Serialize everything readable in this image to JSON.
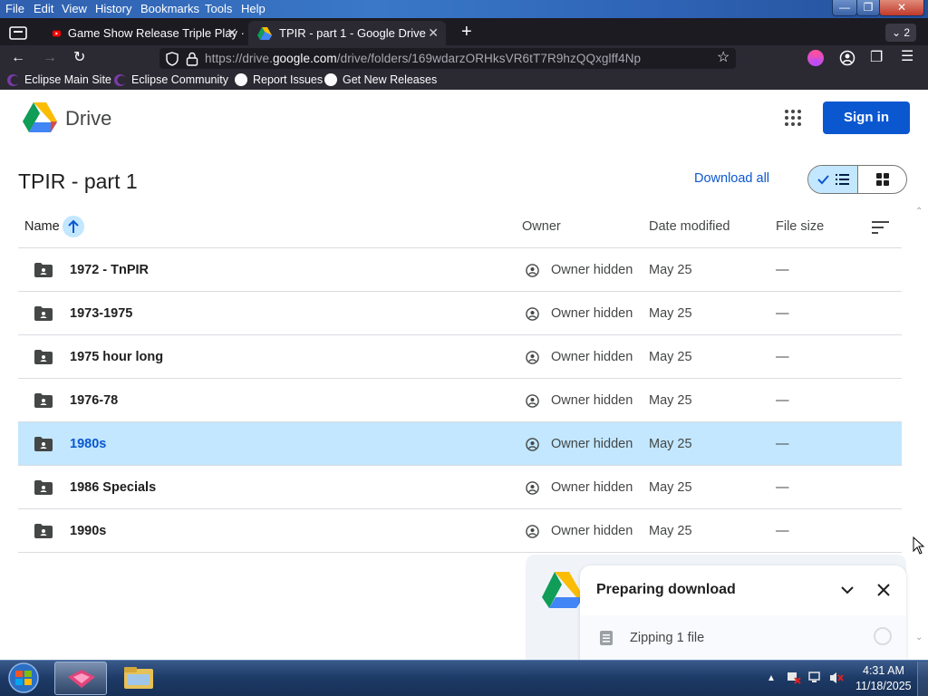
{
  "browser": {
    "menu": [
      "File",
      "Edit",
      "View",
      "History",
      "Bookmarks",
      "Tools",
      "Help"
    ],
    "tabs": [
      {
        "title": "Game Show Release Triple Play ·"
      },
      {
        "title": "TPIR - part 1 - Google Drive"
      }
    ],
    "tab_count": "2",
    "url_prefix": "https://drive.",
    "url_host": "google.com",
    "url_path": "/drive/folders/169wdarzORHksVR6tT7R9hzQQxglff4Np",
    "bookmarks": [
      {
        "label": "Eclipse Main Site",
        "icon": "eclipse-icon"
      },
      {
        "label": "Eclipse Community",
        "icon": "eclipse-icon"
      },
      {
        "label": "Report Issues",
        "icon": "github-icon"
      },
      {
        "label": "Get New Releases",
        "icon": "github-icon"
      }
    ]
  },
  "drive": {
    "app_name": "Drive",
    "sign_in": "Sign in",
    "folder_title": "TPIR - part 1",
    "download_all": "Download all",
    "columns": {
      "name": "Name",
      "owner": "Owner",
      "date": "Date modified",
      "size": "File size"
    },
    "rows": [
      {
        "name": "1972 - TnPIR",
        "owner": "Owner hidden",
        "date": "May 25",
        "size": "—"
      },
      {
        "name": "1973-1975",
        "owner": "Owner hidden",
        "date": "May 25",
        "size": "—"
      },
      {
        "name": "1975 hour long",
        "owner": "Owner hidden",
        "date": "May 25",
        "size": "—"
      },
      {
        "name": "1976-78",
        "owner": "Owner hidden",
        "date": "May 25",
        "size": "—"
      },
      {
        "name": "1980s",
        "owner": "Owner hidden",
        "date": "May 25",
        "size": "—"
      },
      {
        "name": "1986 Specials",
        "owner": "Owner hidden",
        "date": "May 25",
        "size": "—"
      },
      {
        "name": "1990s",
        "owner": "Owner hidden",
        "date": "May 25",
        "size": "—"
      }
    ],
    "selected_row": "1980s"
  },
  "download": {
    "title": "Preparing download",
    "status": "Zipping 1 file"
  },
  "taskbar": {
    "time": "4:31 AM",
    "date": "11/18/2025"
  },
  "colors": {
    "accent": "#0b57d0",
    "selected_row": "#c2e7ff",
    "browser_dark": "#1c1b22"
  }
}
